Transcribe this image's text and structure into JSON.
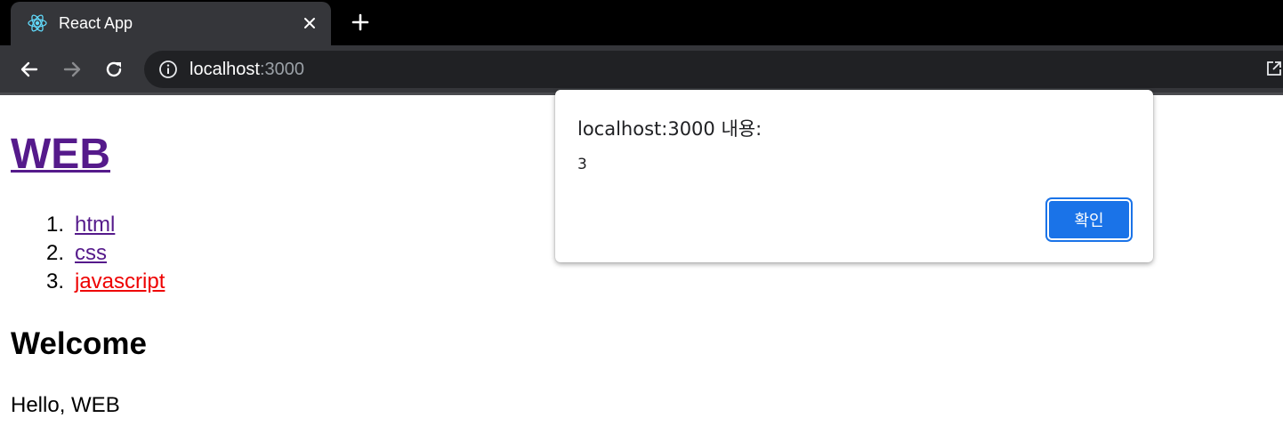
{
  "browser": {
    "tab": {
      "title": "React App",
      "favicon": "react-logo-icon"
    },
    "address": {
      "host": "localhost",
      "port": ":3000"
    },
    "colors": {
      "tabstrip": "#000000",
      "toolbar": "#35363a",
      "omnibox": "#202124"
    }
  },
  "page": {
    "title": "WEB",
    "nav": [
      {
        "number": "1.",
        "label": "html",
        "active": false
      },
      {
        "number": "2.",
        "label": "css",
        "active": false
      },
      {
        "number": "3.",
        "label": "javascript",
        "active": true
      }
    ],
    "article": {
      "title": "Welcome",
      "body": "Hello, WEB"
    },
    "colors": {
      "visited_link": "#551a8b",
      "active_link": "#ee0000"
    }
  },
  "alert": {
    "title": "localhost:3000 내용:",
    "message": "3",
    "ok_label": "확인",
    "colors": {
      "button": "#1a73e8"
    }
  }
}
